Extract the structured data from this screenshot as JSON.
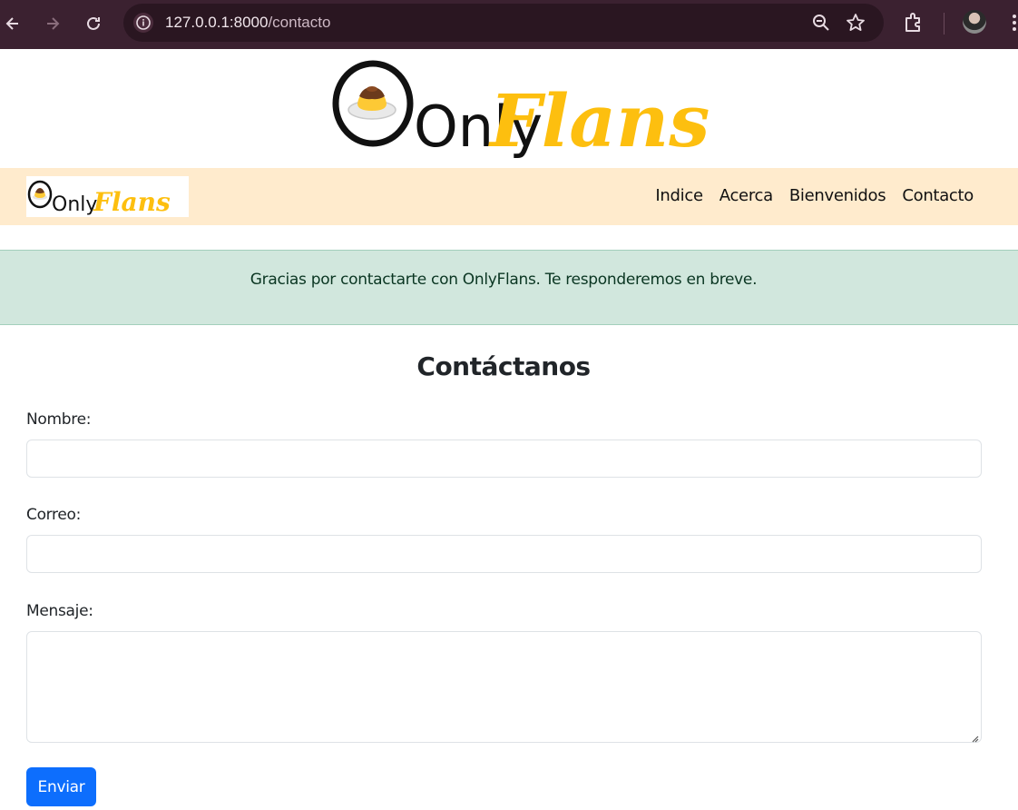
{
  "browser": {
    "url_host": "127.0.0.1:8000",
    "url_path": "/contacto"
  },
  "site": {
    "logo_text_left": "Only",
    "logo_text_right": "Flans"
  },
  "navbar": {
    "items": [
      {
        "label": "Indice"
      },
      {
        "label": "Acerca"
      },
      {
        "label": "Bienvenidos"
      },
      {
        "label": "Contacto"
      }
    ]
  },
  "alert": {
    "message": "Gracias por contactarte con OnlyFlans. Te responderemos en breve."
  },
  "form": {
    "title": "Contáctanos",
    "name_label": "Nombre:",
    "name_value": "",
    "email_label": "Correo:",
    "email_value": "",
    "message_label": "Mensaje:",
    "submit_label": "Enviar"
  },
  "colors": {
    "accent_yellow": "#fdbf0f",
    "navbar_bg": "#ffebcd",
    "alert_bg": "#d1e7dd",
    "button_blue": "#0d6efd",
    "chrome_bg": "#3b2130"
  }
}
